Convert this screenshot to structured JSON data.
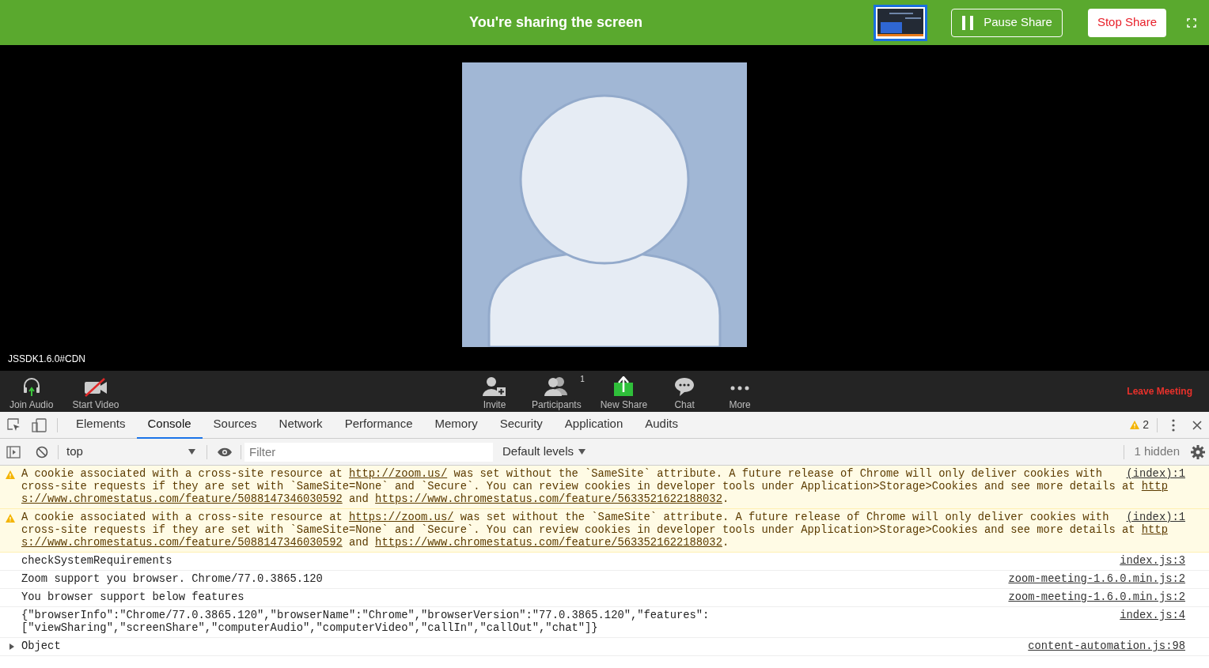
{
  "share_bar": {
    "title": "You're sharing the screen",
    "pause_button": "Pause Share",
    "stop_button": "Stop Share"
  },
  "video": {
    "label": "JSSDK1.6.0#CDN"
  },
  "toolbar": {
    "left": [
      {
        "kind": "audio",
        "label": "Join Audio"
      },
      {
        "kind": "video",
        "label": "Start Video"
      }
    ],
    "center": [
      {
        "kind": "invite",
        "label": "Invite"
      },
      {
        "kind": "participants",
        "label": "Participants",
        "count": "1"
      },
      {
        "kind": "share",
        "label": "New Share"
      },
      {
        "kind": "chat",
        "label": "Chat"
      },
      {
        "kind": "more",
        "label": "More"
      }
    ],
    "leave_button": "Leave Meeting"
  },
  "devtools": {
    "tabs": [
      {
        "label": "Elements",
        "selected": false
      },
      {
        "label": "Console",
        "selected": true
      },
      {
        "label": "Sources",
        "selected": false
      },
      {
        "label": "Network",
        "selected": false
      },
      {
        "label": "Performance",
        "selected": false
      },
      {
        "label": "Memory",
        "selected": false
      },
      {
        "label": "Security",
        "selected": false
      },
      {
        "label": "Application",
        "selected": false
      },
      {
        "label": "Audits",
        "selected": false
      }
    ],
    "warning_count": "2",
    "context": "top",
    "filter_placeholder": "Filter",
    "levels": "Default levels",
    "hidden": "1 hidden",
    "messages": [
      {
        "kind": "warning",
        "lines": [
          [
            {
              "kind": "text",
              "text": "A cookie associated with a cross-site resource at "
            },
            {
              "kind": "link",
              "text": "http://zoom.us/"
            },
            {
              "kind": "text",
              "text": " was set without the `SameSite` attribute. A future release of Chrome will only deliver cookies with"
            }
          ],
          [
            {
              "kind": "text",
              "text": "cross-site requests if they are set with `SameSite=None` and `Secure`. You can review cookies in developer tools under Application>Storage>Cookies and see more details at "
            },
            {
              "kind": "link",
              "text": "http"
            }
          ],
          [
            {
              "kind": "link",
              "text": "s://www.chromestatus.com/feature/5088147346030592"
            },
            {
              "kind": "text",
              "text": " and "
            },
            {
              "kind": "link",
              "text": "https://www.chromestatus.com/feature/5633521622188032"
            },
            {
              "kind": "text",
              "text": "."
            }
          ]
        ],
        "source": "(index):1"
      },
      {
        "kind": "warning",
        "lines": [
          [
            {
              "kind": "text",
              "text": "A cookie associated with a cross-site resource at "
            },
            {
              "kind": "link",
              "text": "https://zoom.us/"
            },
            {
              "kind": "text",
              "text": " was set without the `SameSite` attribute. A future release of Chrome will only deliver cookies with"
            }
          ],
          [
            {
              "kind": "text",
              "text": "cross-site requests if they are set with `SameSite=None` and `Secure`. You can review cookies in developer tools under Application>Storage>Cookies and see more details at "
            },
            {
              "kind": "link",
              "text": "http"
            }
          ],
          [
            {
              "kind": "link",
              "text": "s://www.chromestatus.com/feature/5088147346030592"
            },
            {
              "kind": "text",
              "text": " and "
            },
            {
              "kind": "link",
              "text": "https://www.chromestatus.com/feature/5633521622188032"
            },
            {
              "kind": "text",
              "text": "."
            }
          ]
        ],
        "source": "(index):1"
      },
      {
        "kind": "log",
        "lines": [
          [
            {
              "kind": "text",
              "text": "checkSystemRequirements"
            }
          ]
        ],
        "source": "index.js:3"
      },
      {
        "kind": "log",
        "lines": [
          [
            {
              "kind": "text",
              "text": "Zoom support you browser. Chrome/77.0.3865.120"
            }
          ]
        ],
        "source": "zoom-meeting-1.6.0.min.js:2"
      },
      {
        "kind": "log",
        "lines": [
          [
            {
              "kind": "text",
              "text": "You browser support below features"
            }
          ]
        ],
        "source": "zoom-meeting-1.6.0.min.js:2"
      },
      {
        "kind": "log",
        "lines": [
          [
            {
              "kind": "text",
              "text": "{\"browserInfo\":\"Chrome/77.0.3865.120\",\"browserName\":\"Chrome\",\"browserVersion\":\"77.0.3865.120\",\"features\":"
            }
          ],
          [
            {
              "kind": "text",
              "text": "[\"viewSharing\",\"screenShare\",\"computerAudio\",\"computerVideo\",\"callIn\",\"callOut\",\"chat\"]}"
            }
          ]
        ],
        "source": "index.js:4"
      },
      {
        "kind": "object",
        "expanded": false,
        "lines": [
          [
            {
              "kind": "text",
              "text": "Object"
            }
          ]
        ],
        "source": "content-automation.js:98"
      }
    ]
  }
}
